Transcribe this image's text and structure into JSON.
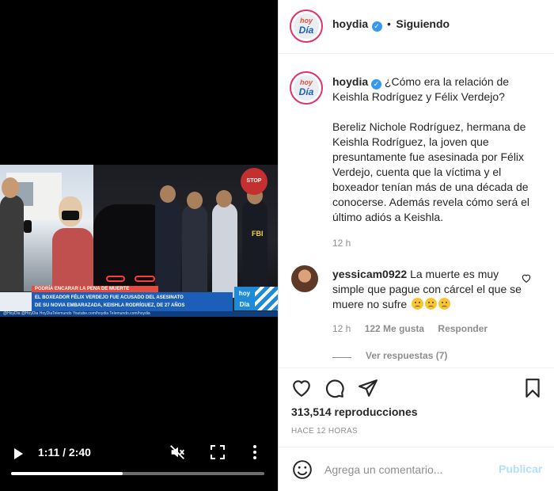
{
  "video": {
    "ticker_top": "PODRÍA ENCARAR LA PENA DE MUERTE",
    "ticker_line1": "EL BOXEADOR FÉLIX VERDEJO FUE ACUSADO DEL ASESINATO",
    "ticker_line2": "DE SU NOVIA EMBARAZADA, KEISHLA RODRÍGUEZ, DE 27 AÑOS",
    "ticker_logo": "hoy Día",
    "handles": "@HoyDia   @HoyDia   HoyDiaTelemundo   Youtube.com/hoydia   Telemundo.com/hoydia",
    "stop_sign": "STOP",
    "fbi_label": "FBI",
    "time_display": "1:11 / 2:40",
    "progress_fraction": 0.44
  },
  "header": {
    "username": "hoydia",
    "follow_status": "Siguiendo",
    "separator": "•",
    "verified_mark": "✓"
  },
  "avatar": {
    "line1": "hoy",
    "line2": "Día"
  },
  "caption": {
    "username": "hoydia",
    "question": "¿Cómo era la relación de Keishla Rodríguez y Félix Verdejo?",
    "body": "Bereliz Nichole Rodríguez, hermana de Keishla Rodríguez, la joven que presuntamente fue asesinada por Félix Verdejo, cuenta que la víctima y el boxeador tenían más de una década de conocerse. Además revela cómo será el último adiós a Keishla.",
    "age": "12 h"
  },
  "comment": {
    "username": "yessicam0922",
    "text": "La muerte es muy simple que pague con cárcel el que se muere no sufre",
    "age": "12 h",
    "likes": "122 Me gusta",
    "reply_label": "Responder",
    "view_replies": "Ver respuestas (7)"
  },
  "stats": {
    "views": "313,514 reproducciones",
    "time_ago": "HACE 12 HORAS"
  },
  "add_comment": {
    "placeholder": "Agrega un comentario...",
    "publish_label": "Publicar"
  },
  "icons": {
    "like": "heart-icon",
    "comment": "comment-icon",
    "share": "paper-plane-icon",
    "save": "bookmark-icon",
    "emoji": "smiley-icon"
  },
  "colors": {
    "verified": "#3897f0",
    "publish_disabled": "#b2dffc",
    "ticker_blue": "#1c5fb8",
    "ticker_red": "#e64c3c"
  }
}
